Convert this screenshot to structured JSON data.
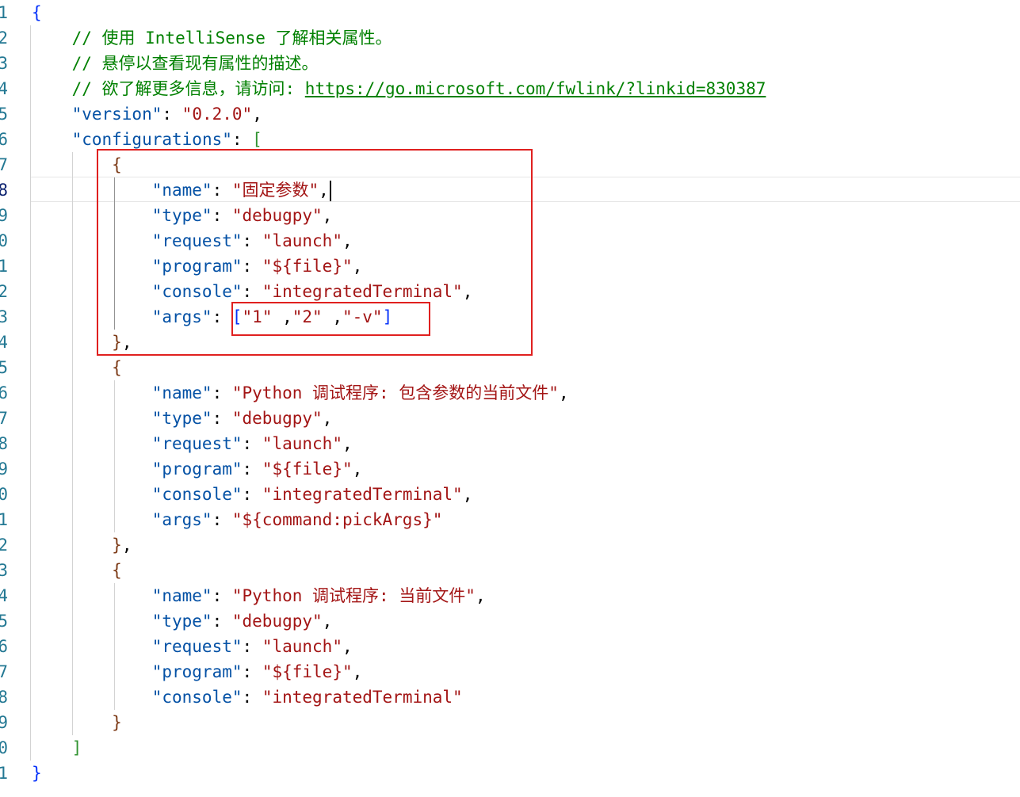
{
  "line_numbers": [
    "1",
    "2",
    "3",
    "4",
    "5",
    "6",
    "7",
    "8",
    "9",
    "0",
    "1",
    "2",
    "3",
    "4",
    "5",
    "6",
    "7",
    "8",
    "9",
    "0",
    "1",
    "2",
    "3",
    "4",
    "5",
    "6",
    "7",
    "8",
    "9",
    "0",
    "1"
  ],
  "code": {
    "l1_open": "{",
    "comment1": "// 使用 IntelliSense 了解相关属性。",
    "comment2": "// 悬停以查看现有属性的描述。",
    "comment3_prefix": "// 欲了解更多信息，请访问: ",
    "comment3_link": "https://go.microsoft.com/fwlink/?linkid=830387",
    "version_key": "\"version\"",
    "version_val": "\"0.2.0\"",
    "configurations_key": "\"configurations\"",
    "config1": {
      "name_key": "\"name\"",
      "name_val": "\"固定参数\"",
      "type_key": "\"type\"",
      "type_val": "\"debugpy\"",
      "request_key": "\"request\"",
      "request_val": "\"launch\"",
      "program_key": "\"program\"",
      "program_val": "\"${file}\"",
      "console_key": "\"console\"",
      "console_val": "\"integratedTerminal\"",
      "args_key": "\"args\"",
      "args_a1": "\"1\"",
      "args_a2": "\"2\"",
      "args_a3": "\"-v\""
    },
    "config2": {
      "name_key": "\"name\"",
      "name_val": "\"Python 调试程序: 包含参数的当前文件\"",
      "type_key": "\"type\"",
      "type_val": "\"debugpy\"",
      "request_key": "\"request\"",
      "request_val": "\"launch\"",
      "program_key": "\"program\"",
      "program_val": "\"${file}\"",
      "console_key": "\"console\"",
      "console_val": "\"integratedTerminal\"",
      "args_key": "\"args\"",
      "args_val": "\"${command:pickArgs}\""
    },
    "config3": {
      "name_key": "\"name\"",
      "name_val": "\"Python 调试程序: 当前文件\"",
      "type_key": "\"type\"",
      "type_val": "\"debugpy\"",
      "request_key": "\"request\"",
      "request_val": "\"launch\"",
      "program_key": "\"program\"",
      "program_val": "\"${file}\"",
      "console_key": "\"console\"",
      "console_val": "\"integratedTerminal\""
    }
  },
  "colors": {
    "key": "#0451a5",
    "string": "#a31515",
    "comment": "#008000",
    "line_number": "#237893",
    "bracket_level1": "#0431fa",
    "bracket_level2": "#319331",
    "bracket_level3": "#7b3814",
    "annotation_box": "#e0201f"
  }
}
